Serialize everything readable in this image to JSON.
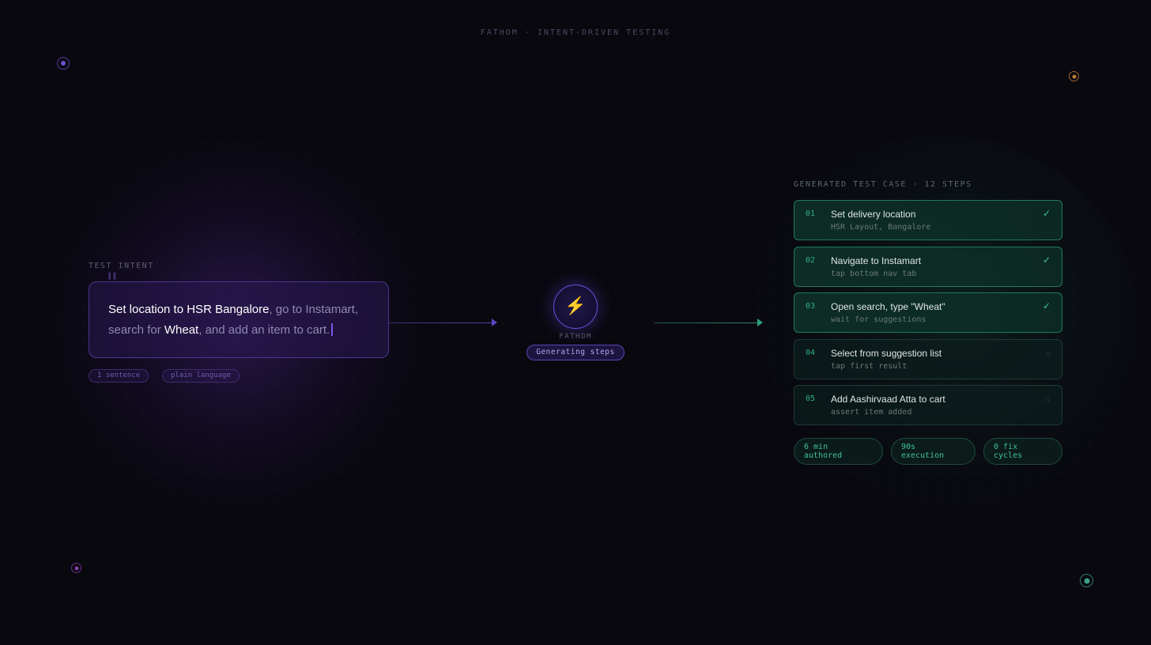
{
  "header": {
    "title": "FATHOM · INTENT-DRIVEN TESTING"
  },
  "intent": {
    "label": "TEST INTENT",
    "quote_glyph": "\"",
    "text_part1": "Set location to HSR Bangalore",
    "text_part2": ", go to Instamart, search for ",
    "text_part3": "Wheat",
    "text_part4": ", and add an item to cart.",
    "tags": [
      "1 sentence",
      "plain language"
    ]
  },
  "engine": {
    "icon": "lightning-bolt-icon",
    "icon_glyph": "⚡",
    "name": "FATHOM",
    "status": "Generating steps"
  },
  "test_case": {
    "header": "GENERATED TEST CASE · 12 STEPS",
    "steps": [
      {
        "num": "01",
        "title": "Set delivery location",
        "sub": "HSR Layout, Bangalore",
        "state": "done",
        "state_glyph": "✓"
      },
      {
        "num": "02",
        "title": "Navigate to Instamart",
        "sub": "tap bottom nav tab",
        "state": "done",
        "state_glyph": "✓"
      },
      {
        "num": "03",
        "title": "Open search, type \"Wheat\"",
        "sub": "wait for suggestions",
        "state": "done",
        "state_glyph": "✓"
      },
      {
        "num": "04",
        "title": "Select from suggestion list",
        "sub": "tap first result",
        "state": "pending",
        "state_glyph": "○"
      },
      {
        "num": "05",
        "title": "Add Aashirvaad Atta to cart",
        "sub": "assert item added",
        "state": "pending",
        "state_glyph": "○"
      }
    ],
    "stats": [
      {
        "value": "6 min",
        "label": "authored"
      },
      {
        "value": "90s",
        "label": "execution"
      },
      {
        "value": "0 fix",
        "label": "cycles"
      }
    ]
  },
  "colors": {
    "background": "#09080f",
    "accent_purple": "#6a4fe0",
    "accent_green": "#2fb083",
    "bolt": "#f0c030"
  }
}
